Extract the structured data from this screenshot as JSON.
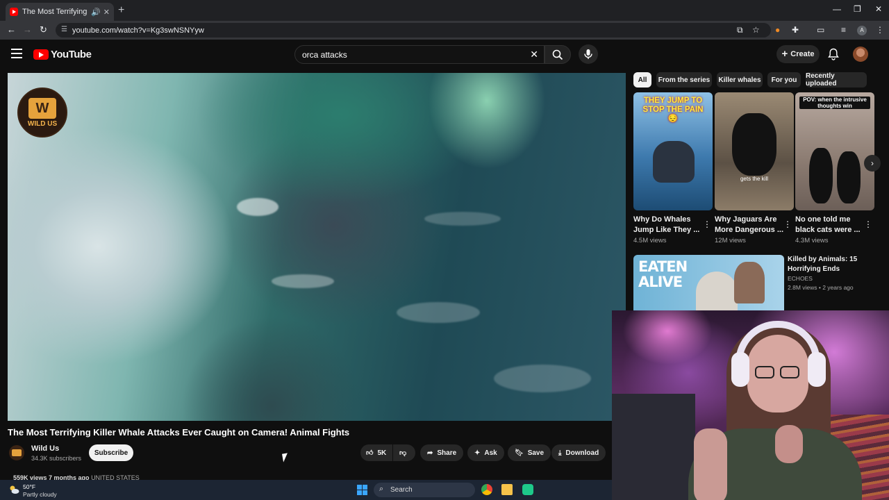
{
  "browser": {
    "tab_title": "The Most Terrifying Killer W",
    "url": "youtube.com/watch?v=Kg3swNSNYyw",
    "profile_initial": "A"
  },
  "youtube": {
    "logo_text": "YouTube",
    "search_value": "orca attacks",
    "create_label": "Create"
  },
  "video": {
    "watermark_text": "WILD US",
    "title": "The Most Terrifying Killer Whale Attacks Ever Caught on Camera! Animal Fights",
    "channel_name": "Wild Us",
    "subscribers": "34.3K subscribers",
    "subscribe_label": "Subscribe",
    "likes": "5K",
    "share_label": "Share",
    "ask_label": "Ask",
    "save_label": "Save",
    "download_label": "Download",
    "views_time": "559K views  7 months ago",
    "location": "UNITED STATES"
  },
  "sidebar": {
    "chips": [
      "All",
      "From the series",
      "Killer whales",
      "For you",
      "Recently uploaded"
    ],
    "shorts": [
      {
        "caption": "THEY JUMP TO STOP THE PAIN 😔",
        "title": "Why Do Whales Jump Like They ...",
        "views": "4.5M views"
      },
      {
        "caption": "gets the kill",
        "title": "Why Jaguars Are More Dangerous ...",
        "views": "12M views"
      },
      {
        "caption": "POV: when the intrusive thoughts win",
        "title": "No one told me black cats were ...",
        "views": "4.3M views"
      }
    ],
    "recommended": {
      "thumb_text": "EATEN ALIVE",
      "title": "Killed by Animals: 15 Horrifying Ends",
      "channel": "ECHOES",
      "meta": "2.8M views • 2 years ago"
    }
  },
  "taskbar": {
    "temperature": "50°F",
    "condition": "Partly cloudy",
    "search_label": "Search"
  }
}
